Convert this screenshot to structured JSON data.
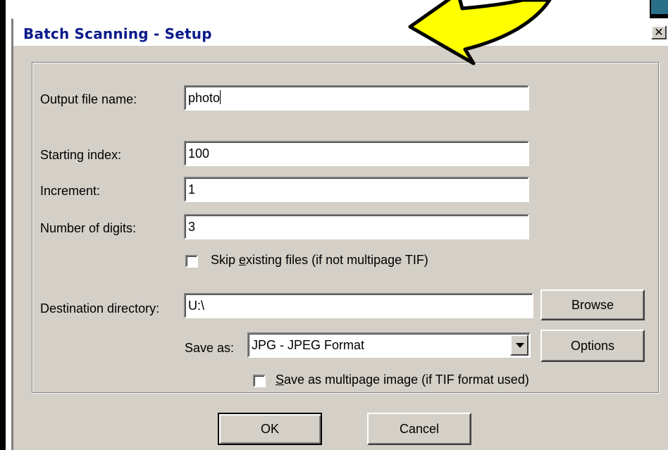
{
  "window": {
    "title": "Batch Scanning - Setup",
    "close_glyph": "✕"
  },
  "form": {
    "output_file_label": "Output file name:",
    "output_file_value": "photo",
    "starting_index_label": "Starting index:",
    "starting_index_value": "100",
    "increment_label": "Increment:",
    "increment_value": "1",
    "digits_label": "Number of digits:",
    "digits_value": "3",
    "skip_existing_label_pre": "Skip ",
    "skip_existing_label_u": "e",
    "skip_existing_label_post": "xisting files (if not multipage TIF)",
    "skip_existing_checked": false,
    "destination_label": "Destination directory:",
    "destination_value": "U:\\",
    "browse_label": "Browse",
    "save_as_label": "Save as:",
    "save_as_value": "JPG - JPEG Format",
    "options_label": "Options",
    "multipage_label_u": "S",
    "multipage_label_post": "ave as multipage image (if TIF format used)",
    "multipage_checked": false
  },
  "buttons": {
    "ok_label": "OK",
    "cancel_label": "Cancel"
  },
  "annotation": {
    "arrow_color": "#ffff00"
  }
}
